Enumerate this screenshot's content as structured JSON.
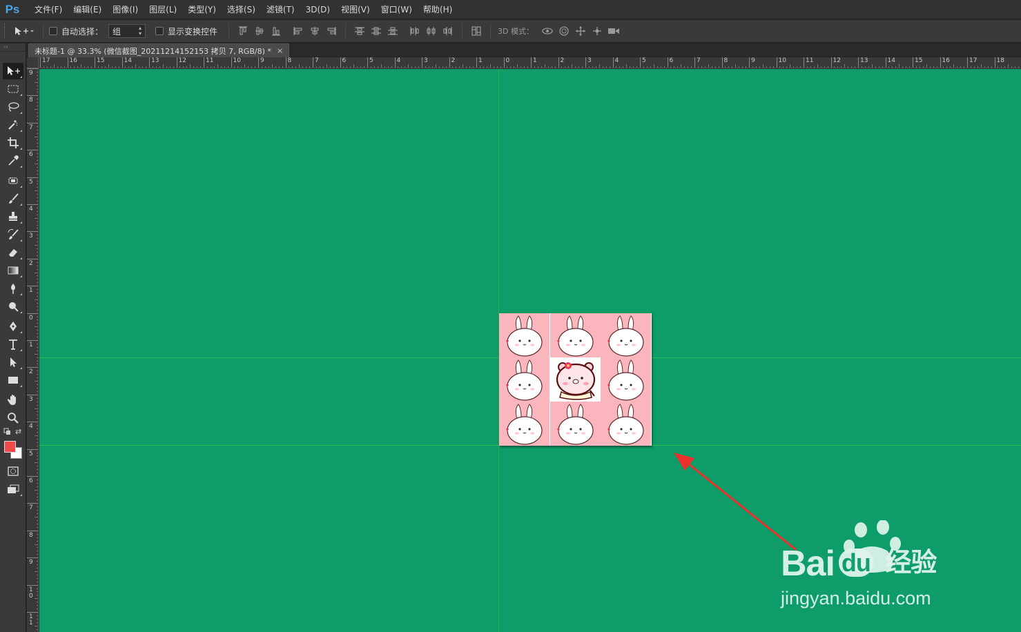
{
  "app": {
    "logo": "Ps"
  },
  "menu": [
    "文件(F)",
    "编辑(E)",
    "图像(I)",
    "图层(L)",
    "类型(Y)",
    "选择(S)",
    "滤镜(T)",
    "3D(D)",
    "视图(V)",
    "窗口(W)",
    "帮助(H)"
  ],
  "options": {
    "auto_select_label": "自动选择：",
    "auto_select_value": "组",
    "show_transform_label": "显示变换控件",
    "mode3d_label": "3D 模式："
  },
  "document_tab": {
    "title": "未标题-1 @ 33.3% (微信截图_20211214152153 拷贝 7, RGB/8) *",
    "close": "×"
  },
  "rulers": {
    "horizontal": [
      "17",
      "16",
      "15",
      "14",
      "13",
      "12",
      "11",
      "10",
      "9",
      "8",
      "7",
      "6",
      "5",
      "4",
      "3",
      "2",
      "1",
      "0",
      "1",
      "2",
      "3",
      "4",
      "5",
      "6",
      "7",
      "8",
      "9",
      "10",
      "11",
      "12",
      "13",
      "14",
      "15",
      "16",
      "17",
      "18"
    ],
    "vertical": [
      "9",
      "8",
      "7",
      "6",
      "5",
      "4",
      "3",
      "2",
      "1",
      "0",
      "1",
      "2",
      "3",
      "4",
      "5",
      "6",
      "7",
      "8",
      "9",
      "1\n0",
      "1\n1"
    ]
  },
  "colors": {
    "canvas_bg": "#0e9c69",
    "foreground": "#f04a4a",
    "background": "#ffffff",
    "tile_pink": "#fbb5bd",
    "arrow": "#e8322b"
  },
  "watermark": {
    "brand": "Bai",
    "brand_tail": "du",
    "brand_cn": "经验",
    "url": "jingyan.baidu.com"
  },
  "icons": {
    "move": "move-tool-icon",
    "marquee": "marquee-tool-icon",
    "lasso": "lasso-tool-icon",
    "magic_wand": "magic-wand-icon",
    "crop": "crop-tool-icon",
    "eyedropper": "eyedropper-icon",
    "healing": "healing-brush-icon",
    "brush": "brush-tool-icon",
    "stamp": "clone-stamp-icon",
    "history_brush": "history-brush-icon",
    "eraser": "eraser-icon",
    "gradient": "gradient-tool-icon",
    "blur": "blur-tool-icon",
    "dodge": "dodge-tool-icon",
    "pen": "pen-tool-icon",
    "type": "type-tool-icon",
    "path_select": "path-selection-icon",
    "shape": "rectangle-tool-icon",
    "hand": "hand-tool-icon",
    "zoom": "zoom-tool-icon"
  }
}
